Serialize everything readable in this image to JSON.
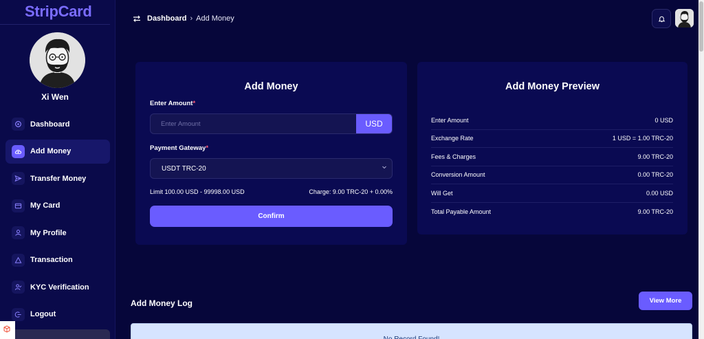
{
  "brand": {
    "name": "StripCard"
  },
  "user": {
    "name": "Xi Wen"
  },
  "sidebar": {
    "items": [
      {
        "label": "Dashboard",
        "icon": "dashboard-icon",
        "active": false
      },
      {
        "label": "Add Money",
        "icon": "cloud-upload-icon",
        "active": true
      },
      {
        "label": "Transfer Money",
        "icon": "send-icon",
        "active": false
      },
      {
        "label": "My Card",
        "icon": "card-icon",
        "active": false
      },
      {
        "label": "My Profile",
        "icon": "user-icon",
        "active": false
      },
      {
        "label": "Transaction",
        "icon": "triangle-icon",
        "active": false
      },
      {
        "label": "KYC Verification",
        "icon": "user-check-icon",
        "active": false
      },
      {
        "label": "Logout",
        "icon": "logout-icon",
        "active": false
      }
    ]
  },
  "breadcrumb": {
    "home": "Dashboard",
    "current": "Add Money"
  },
  "add_money": {
    "title": "Add Money",
    "amount_label": "Enter Amount",
    "required_mark": "*",
    "amount_placeholder": "Enter Amount",
    "amount_value": "",
    "currency": "USD",
    "gateway_label": "Payment Gateway",
    "gateway_selected": "USDT TRC-20",
    "limit": "Limit 100.00 USD - 99998.00 USD",
    "charge": "Charge: 9.00 TRC-20 + 0.00%",
    "confirm_label": "Confirm"
  },
  "preview": {
    "title": "Add Money Preview",
    "rows": [
      {
        "label": "Enter Amount",
        "value": "0 USD"
      },
      {
        "label": "Exchange Rate",
        "value": "1 USD = 1.00 TRC-20"
      },
      {
        "label": "Fees & Charges",
        "value": "9.00 TRC-20"
      },
      {
        "label": "Conversion Amount",
        "value": "0.00 TRC-20"
      },
      {
        "label": "Will Get",
        "value": "0.00 USD"
      },
      {
        "label": "Total Payable Amount",
        "value": "9.00 TRC-20"
      }
    ]
  },
  "log": {
    "title": "Add Money Log",
    "view_more_label": "View More",
    "empty_message": "No Record Found!"
  },
  "colors": {
    "background": "#06063a",
    "sidebar": "#0a0a4a",
    "card": "#0a0a52",
    "accent": "#6a5cff",
    "brand": "#7a6cff",
    "alert_bg": "#d6e4ff"
  }
}
